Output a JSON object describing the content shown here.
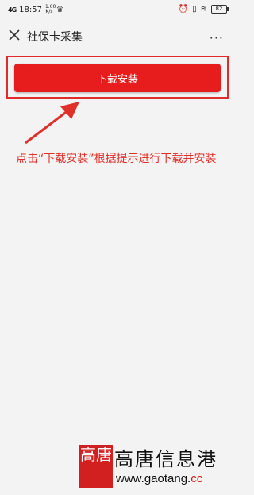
{
  "status_bar": {
    "signal": "4G",
    "time": "18:57",
    "net_speed": "1.00 K/s",
    "battery": "82"
  },
  "header": {
    "title": "社保卡采集",
    "more": "···"
  },
  "download_button": {
    "label": "下载安装"
  },
  "instruction": {
    "text": "点击“下载安装”根据提示进行下载并安装"
  },
  "watermark": {
    "logo_chars": "高唐",
    "brand": "高唐信息港",
    "url_main": "www.gaotang.",
    "url_tld": "cc"
  },
  "colors": {
    "accent_red": "#e71d1d",
    "annotation_red": "#e0302a",
    "background": "#f3f3f3"
  }
}
